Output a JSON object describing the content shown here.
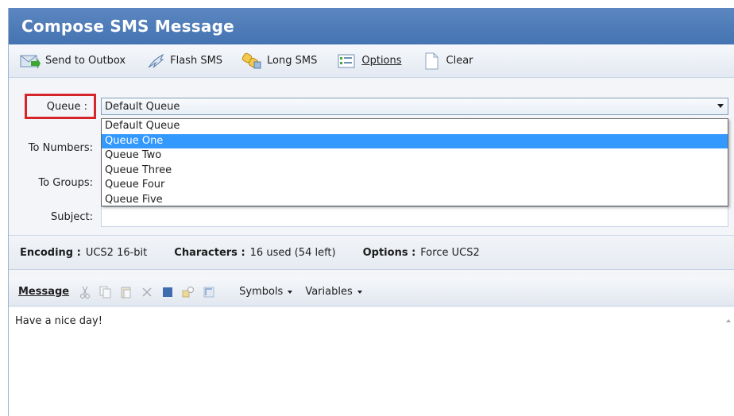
{
  "window": {
    "title": "Compose SMS Message"
  },
  "toolbar": {
    "send": "Send to Outbox",
    "flash": "Flash SMS",
    "long": "Long SMS",
    "options": "Options",
    "clear": "Clear"
  },
  "form": {
    "queue_label": "Queue :",
    "queue_value": "Default Queue",
    "to_numbers_label": "To Numbers:",
    "to_groups_label": "To Groups:",
    "subject_label": "Subject:",
    "queue_options": [
      "Default Queue",
      "Queue One",
      "Queue Two",
      "Queue Three",
      "Queue Four",
      "Queue Five"
    ],
    "highlighted_option": "Queue One"
  },
  "status": {
    "encoding_label": "Encoding :",
    "encoding_value": "UCS2 16-bit",
    "characters_label": "Characters :",
    "characters_value": "16 used (54 left)",
    "options_label": "Options :",
    "options_value": "Force UCS2"
  },
  "message": {
    "label": "Message",
    "symbols_menu": "Symbols",
    "variables_menu": "Variables",
    "body": "Have a nice day!"
  },
  "colors": {
    "title_bar": "#4e7cb9",
    "highlight": "#3399ff",
    "annotation_box": "#d6262a"
  }
}
